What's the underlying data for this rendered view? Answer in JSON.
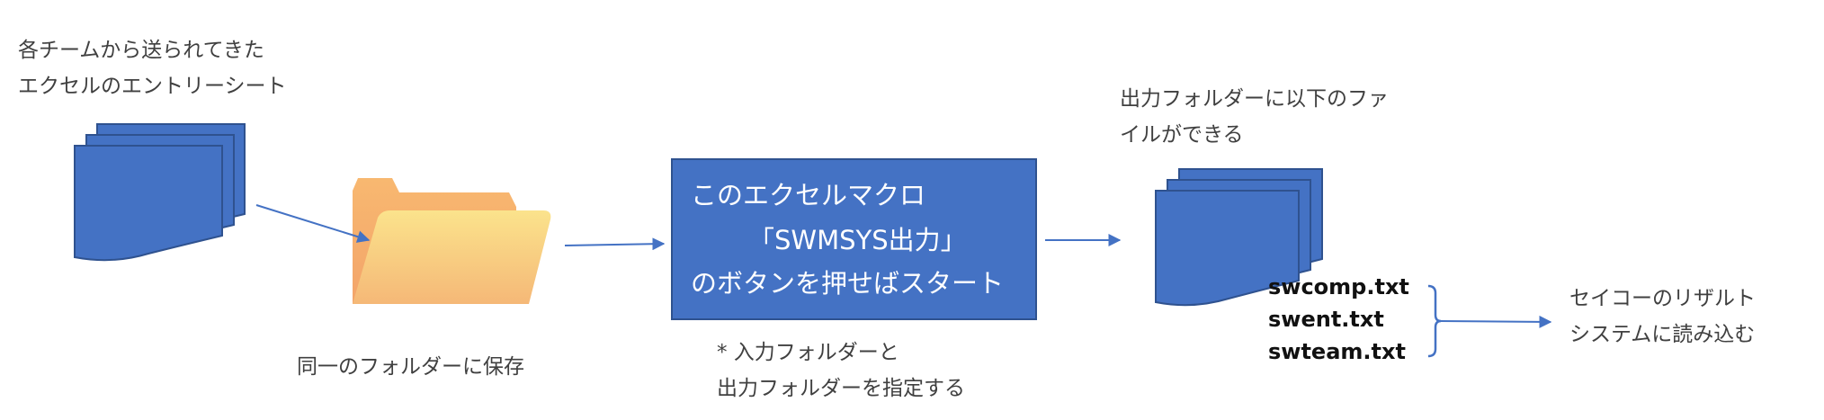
{
  "source_caption": {
    "line1": "各チームから送られてきた",
    "line2": "エクセルのエントリーシート"
  },
  "folder_caption": "同一のフォルダーに保存",
  "macro_box": {
    "line1": "このエクセルマクロ",
    "line2": "「SWMSYS出力」",
    "line3": "のボタンを押せばスタート",
    "fill": "#4472c4"
  },
  "macro_note": {
    "line1": "* 入力フォルダーと",
    "line2": "出力フォルダーを指定する"
  },
  "output_caption": {
    "line1": "出力フォルダーに以下のファ",
    "line2": "イルができる"
  },
  "output_files": [
    "swcomp.txt",
    "swent.txt",
    "swteam.txt"
  ],
  "result_caption": {
    "line1": "セイコーのリザルト",
    "line2": "システムに読み込む"
  },
  "colors": {
    "doc_fill": "#4472c4",
    "doc_stroke": "#2f528f",
    "arrow": "#4472c4",
    "folder_front": "#f8d77a",
    "folder_back": "#f5a96a"
  },
  "icons": [
    "documents-stack-icon",
    "folder-icon",
    "documents-stack-icon"
  ]
}
